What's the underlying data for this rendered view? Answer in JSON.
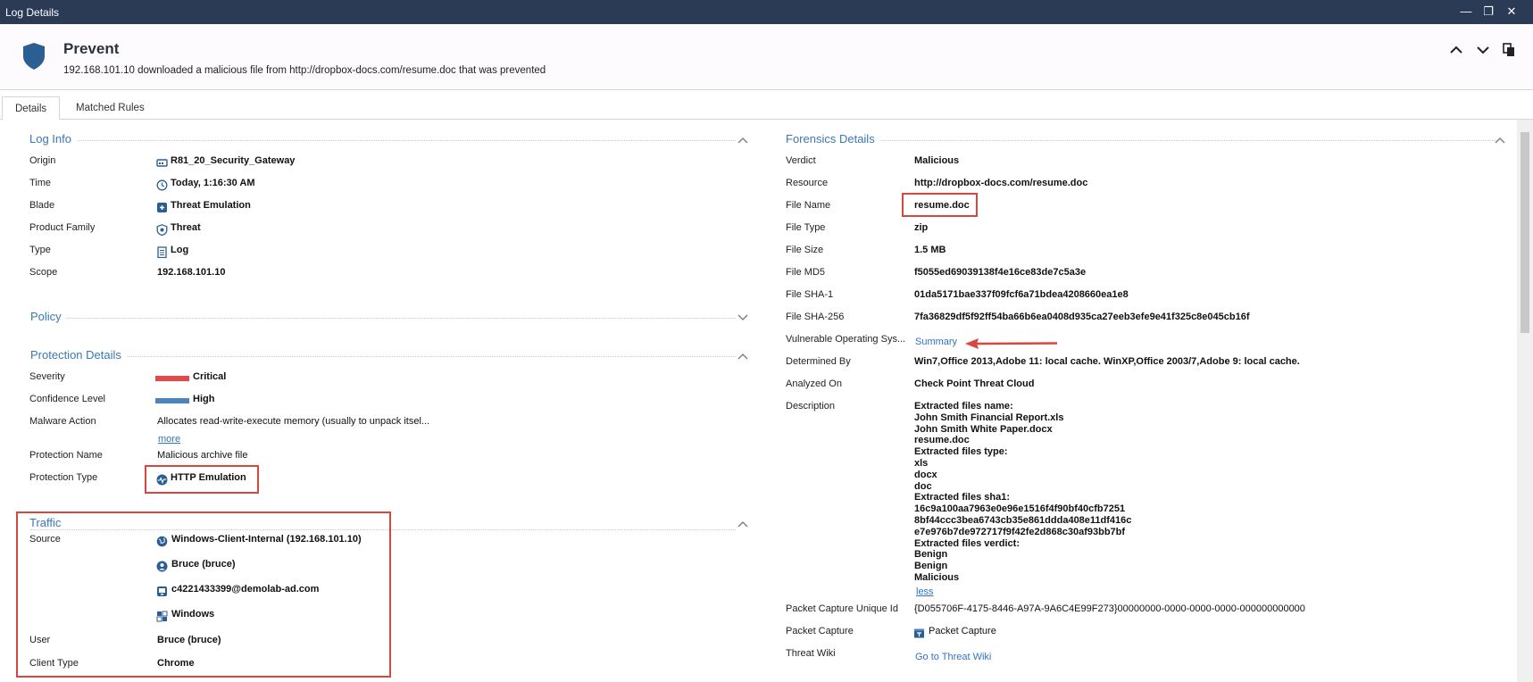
{
  "window": {
    "title": "Log Details",
    "min_glyph": "—",
    "restore_glyph": "❐",
    "close_glyph": "✕"
  },
  "header": {
    "title": "Prevent",
    "subtitle": "192.168.101.10 downloaded a malicious file from http://dropbox-docs.com/resume.doc that was prevented"
  },
  "tabs": [
    {
      "label": "Details",
      "active": true
    },
    {
      "label": "Matched Rules",
      "active": false
    }
  ],
  "log_info": {
    "title": "Log Info",
    "rows": [
      {
        "label": "Origin",
        "value": "R81_20_Security_Gateway",
        "icon": "gateway-icon"
      },
      {
        "label": "Time",
        "value": "Today, 1:16:30 AM",
        "icon": "clock-icon"
      },
      {
        "label": "Blade",
        "value": "Threat Emulation",
        "icon": "threat-emulation-icon"
      },
      {
        "label": "Product Family",
        "value": "Threat",
        "icon": "threat-shield-icon"
      },
      {
        "label": "Type",
        "value": "Log",
        "icon": "log-document-icon"
      },
      {
        "label": "Scope",
        "value": "192.168.101.10"
      }
    ]
  },
  "policy": {
    "title": "Policy"
  },
  "protection": {
    "title": "Protection Details",
    "severity_label": "Severity",
    "severity_value": "Critical",
    "severity_color": "#e8474a",
    "confidence_label": "Confidence Level",
    "confidence_value": "High",
    "confidence_color": "#4f83b9",
    "malware_action_label": "Malware Action",
    "malware_action_value": "Allocates read-write-execute memory (usually to unpack itsel...",
    "more_link": "more",
    "protection_name_label": "Protection Name",
    "protection_name_value": "Malicious archive file",
    "protection_type_label": "Protection Type",
    "protection_type_value": "HTTP Emulation"
  },
  "traffic": {
    "title": "Traffic",
    "source_label": "Source",
    "source_items": [
      {
        "value": "Windows-Client-Internal (192.168.101.10)",
        "icon": "globe-icon"
      },
      {
        "value": "Bruce (bruce)",
        "icon": "user-icon"
      },
      {
        "value": "c4221433399@demolab-ad.com",
        "icon": "computer-icon"
      },
      {
        "value": "Windows",
        "icon": "windows-icon"
      }
    ],
    "user_label": "User",
    "user_value": "Bruce (bruce)",
    "client_type_label": "Client Type",
    "client_type_value": "Chrome"
  },
  "forensics": {
    "title": "Forensics Details",
    "verdict_label": "Verdict",
    "verdict_value": "Malicious",
    "resource_label": "Resource",
    "resource_value": "http://dropbox-docs.com/resume.doc",
    "file_name_label": "File Name",
    "file_name_value": "resume.doc",
    "file_type_label": "File Type",
    "file_type_value": "zip",
    "file_size_label": "File Size",
    "file_size_value": "1.5 MB",
    "md5_label": "File MD5",
    "md5_value": "f5055ed69039138f4e16ce83de7c5a3e",
    "sha1_label": "File SHA-1",
    "sha1_value": "01da5171bae337f09fcf6a71bdea4208660ea1e8",
    "sha256_label": "File SHA-256",
    "sha256_value": "7fa36829df5f92ff54ba66b6ea0408d935ca27eeb3efe9e41f325c8e045cb16f",
    "vuln_os_label": "Vulnerable Operating Sys...",
    "vuln_os_link": "Summary",
    "determined_by_label": "Determined By",
    "determined_by_value": "Win7,Office 2013,Adobe 11: local cache. WinXP,Office 2003/7,Adobe 9: local cache.",
    "analyzed_on_label": "Analyzed On",
    "analyzed_on_value": "Check Point Threat Cloud",
    "description_label": "Description",
    "description_lines": [
      "Extracted files name:",
      "John Smith Financial Report.xls",
      "John Smith White Paper.docx",
      "resume.doc",
      "Extracted files type:",
      "xls",
      "docx",
      "doc",
      "Extracted files sha1:",
      "16c9a100aa7963e0e96e1516f4f90bf40cfb7251",
      "8bf44ccc3bea6743cb35e861ddda408e11df416c",
      "e7e976b7de972717f9f42fe2d868c30af93bb7bf",
      "Extracted files verdict:",
      "Benign",
      "Benign",
      "Malicious"
    ],
    "less_link": "less",
    "pcap_uid_label": "Packet Capture Unique Id",
    "pcap_uid_value": "{D055706F-4175-8446-A97A-9A6C4E99F273}00000000-0000-0000-0000-000000000000",
    "pcap_label": "Packet Capture",
    "pcap_value": "Packet Capture",
    "threat_wiki_label": "Threat Wiki",
    "threat_wiki_link": "Go to Threat Wiki"
  }
}
